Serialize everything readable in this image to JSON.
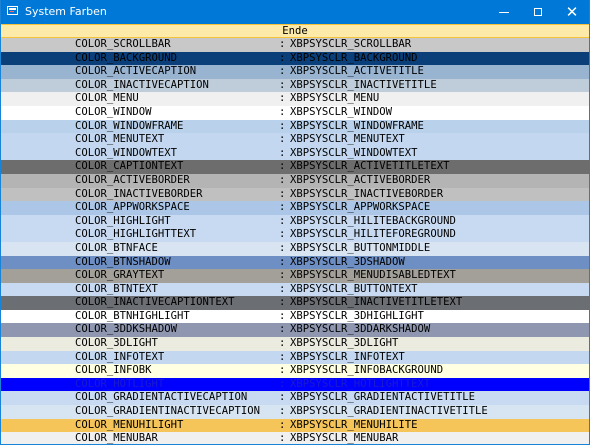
{
  "window": {
    "title": "System Farben",
    "icon": "app-window-icon",
    "controls": [
      "minimize-icon",
      "maximize-icon",
      "close-icon"
    ]
  },
  "header": {
    "label": "Ende"
  },
  "separator": ":",
  "rows": [
    {
      "name": "COLOR_SCROLLBAR",
      "value": "XBPSYSCLR_SCROLLBAR",
      "bg": "#c8c8c8",
      "fg": "#000000"
    },
    {
      "name": "COLOR_BACKGROUND",
      "value": "XBPSYSCLR_BACKGROUND",
      "bg": "#0a3f7a",
      "fg": "#000000"
    },
    {
      "name": "COLOR_ACTIVECAPTION",
      "value": "XBPSYSCLR_ACTIVETITLE",
      "bg": "#99b4d1",
      "fg": "#000000"
    },
    {
      "name": "COLOR_INACTIVECAPTION",
      "value": "XBPSYSCLR_INACTIVETITLE",
      "bg": "#bfcddb",
      "fg": "#000000"
    },
    {
      "name": "COLOR_MENU",
      "value": "XBPSYSCLR_MENU",
      "bg": "#f0f0f0",
      "fg": "#000000"
    },
    {
      "name": "COLOR_WINDOW",
      "value": "XBPSYSCLR_WINDOW",
      "bg": "#ffffff",
      "fg": "#000000"
    },
    {
      "name": "COLOR_WINDOWFRAME",
      "value": "XBPSYSCLR_WINDOWFRAME",
      "bg": "#b9d1ea",
      "fg": "#000000"
    },
    {
      "name": "COLOR_MENUTEXT",
      "value": "XBPSYSCLR_MENUTEXT",
      "bg": "#c3d8f0",
      "fg": "#000000"
    },
    {
      "name": "COLOR_WINDOWTEXT",
      "value": "XBPSYSCLR_WINDOWTEXT",
      "bg": "#c3d8f0",
      "fg": "#000000"
    },
    {
      "name": "COLOR_CAPTIONTEXT",
      "value": "XBPSYSCLR_ACTIVETITLETEXT",
      "bg": "#6d6d6d",
      "fg": "#000000"
    },
    {
      "name": "COLOR_ACTIVEBORDER",
      "value": "XBPSYSCLR_ACTIVEBORDER",
      "bg": "#b4b4b4",
      "fg": "#000000"
    },
    {
      "name": "COLOR_INACTIVEBORDER",
      "value": "XBPSYSCLR_INACTIVEBORDER",
      "bg": "#c0c0c0",
      "fg": "#000000"
    },
    {
      "name": "COLOR_APPWORKSPACE",
      "value": "XBPSYSCLR_APPWORKSPACE",
      "bg": "#abc6e6",
      "fg": "#000000"
    },
    {
      "name": "COLOR_HIGHLIGHT",
      "value": "XBPSYSCLR_HILITEBACKGROUND",
      "bg": "#c8daf2",
      "fg": "#000000"
    },
    {
      "name": "COLOR_HIGHLIGHTTEXT",
      "value": "XBPSYSCLR_HILITEFOREGROUND",
      "bg": "#c8daf2",
      "fg": "#000000"
    },
    {
      "name": "COLOR_BTNFACE",
      "value": "XBPSYSCLR_BUTTONMIDDLE",
      "bg": "#d9e4f2",
      "fg": "#000000"
    },
    {
      "name": "COLOR_BTNSHADOW",
      "value": "XBPSYSCLR_3DSHADOW",
      "bg": "#6e8fc4",
      "fg": "#000000"
    },
    {
      "name": "COLOR_GRAYTEXT",
      "value": "XBPSYSCLR_MENUDISABLEDTEXT",
      "bg": "#a3a09a",
      "fg": "#000000"
    },
    {
      "name": "COLOR_BTNTEXT",
      "value": "XBPSYSCLR_BUTTONTEXT",
      "bg": "#c8daf2",
      "fg": "#000000"
    },
    {
      "name": "COLOR_INACTIVECAPTIONTEXT",
      "value": "XBPSYSCLR_INACTIVETITLETEXT",
      "bg": "#6b6e73",
      "fg": "#000000"
    },
    {
      "name": "COLOR_BTNHIGHLIGHT",
      "value": "XBPSYSCLR_3DHIGHLIGHT",
      "bg": "#ffffff",
      "fg": "#000000"
    },
    {
      "name": "COLOR_3DDKSHADOW",
      "value": "XBPSYSCLR_3DDARKSHADOW",
      "bg": "#8f97b0",
      "fg": "#000000"
    },
    {
      "name": "COLOR_3DLIGHT",
      "value": "XBPSYSCLR_3DLIGHT",
      "bg": "#ebebe0",
      "fg": "#000000"
    },
    {
      "name": "COLOR_INFOTEXT",
      "value": "XBPSYSCLR_INFOTEXT",
      "bg": "#c3d8f0",
      "fg": "#000000"
    },
    {
      "name": "COLOR_INFOBK",
      "value": "XBPSYSCLR_INFOBACKGROUND",
      "bg": "#ffffe1",
      "fg": "#000000"
    },
    {
      "name": "COLOR_HOTLIGHT",
      "value": "XBPSYSCLR_HOTLIGHTTEXT",
      "bg": "#0000ff",
      "fg": "#1a1ad0"
    },
    {
      "name": "COLOR_GRADIENTACTIVECAPTION",
      "value": "XBPSYSCLR_GRADIENTACTIVETITLE",
      "bg": "#c8daf2",
      "fg": "#000000"
    },
    {
      "name": "COLOR_GRADIENTINACTIVECAPTION",
      "value": "XBPSYSCLR_GRADIENTINACTIVETITLE",
      "bg": "#d7e4f2",
      "fg": "#000000"
    },
    {
      "name": "COLOR_MENUHILIGHT",
      "value": "XBPSYSCLR_MENUHILITE",
      "bg": "#f5c55a",
      "fg": "#000000"
    },
    {
      "name": "COLOR_MENUBAR",
      "value": "XBPSYSCLR_MENUBAR",
      "bg": "#f0f0f0",
      "fg": "#000000"
    }
  ]
}
